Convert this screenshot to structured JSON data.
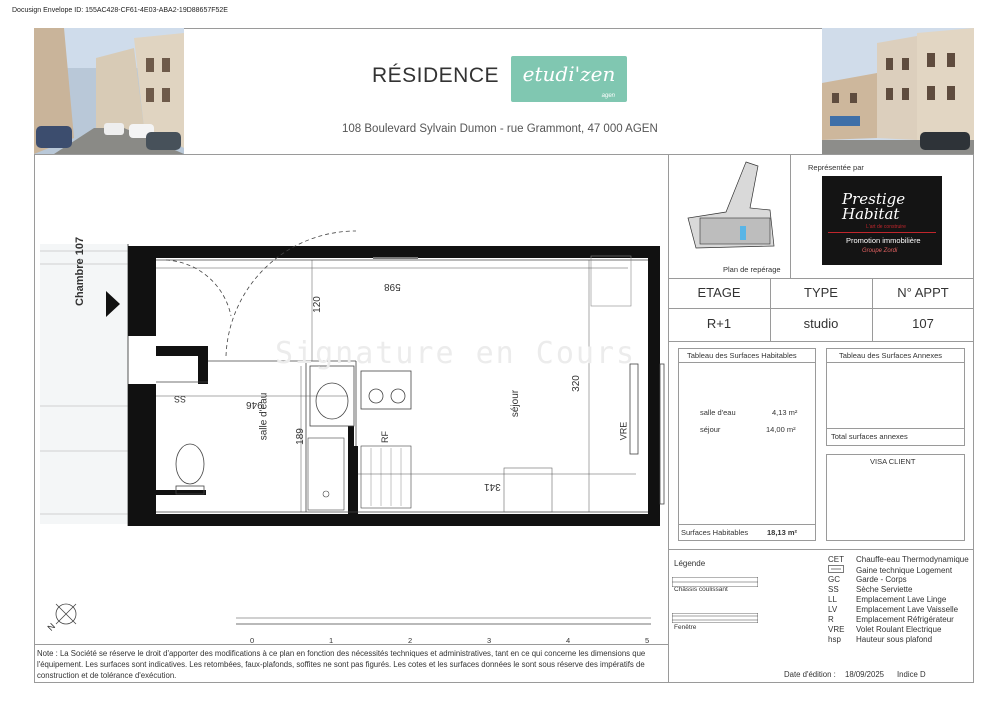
{
  "envelope_id": "Docusign Envelope ID: 155AC428-CF61-4E03-ABA2-19D88657F52E",
  "header": {
    "title": "RÉSIDENCE",
    "logo_text": "etudi'zen",
    "logo_sub": "agen",
    "address": "108 Boulevard Sylvain Dumon - rue Grammont, 47 000 AGEN"
  },
  "plan": {
    "chambre_label": "Chambre 107",
    "watermark": "Signature en Cours",
    "dimensions": [
      "598",
      "120",
      "320",
      "946",
      "189",
      "341"
    ],
    "rooms": {
      "salle_eau": "salle d'eau",
      "sejour": "séjour"
    },
    "codes": {
      "ss": "SS",
      "rf": "RF",
      "vre": "VRE"
    },
    "compass": "N",
    "scale_labels": [
      "0",
      "1",
      "2",
      "3",
      "4",
      "5"
    ]
  },
  "reperage": {
    "label": "Plan de repérage"
  },
  "agency": {
    "represented_by": "Représentée par",
    "name": "Prestige Habitat",
    "tagline": "L'art de construire",
    "line1": "Promotion immobilière",
    "line2": "Groupe Zordi",
    "colors": {
      "bg": "#141414",
      "accent": "#c0262c"
    }
  },
  "info_table": {
    "headers": [
      "ETAGE",
      "TYPE",
      "N° APPT"
    ],
    "values": [
      "R+1",
      "studio",
      "107"
    ]
  },
  "surfaces": {
    "habitables_title": "Tableau des Surfaces Habitables",
    "rows": [
      {
        "label": "salle d'eau",
        "value": "4,13 m²"
      },
      {
        "label": "séjour",
        "value": "14,00 m²"
      }
    ],
    "total_label": "Surfaces Habitables",
    "total_value": "18,13 m²",
    "annexes_title": "Tableau des Surfaces Annexes",
    "annexes_total": "Total surfaces annexes",
    "visa": "VISA CLIENT"
  },
  "legend": {
    "title": "Légende",
    "chassis": "Châssis coulissant",
    "fenetre": "Fenêtre",
    "items": [
      {
        "code": "CET",
        "label": "Chauffe-eau Thermodynamique"
      },
      {
        "code": "",
        "label": "Gaine technique Logement"
      },
      {
        "code": "GC",
        "label": "Garde - Corps"
      },
      {
        "code": "SS",
        "label": "Sèche Serviette"
      },
      {
        "code": "LL",
        "label": "Emplacement Lave Linge"
      },
      {
        "code": "LV",
        "label": "Emplacement Lave Vaisselle"
      },
      {
        "code": "R",
        "label": "Emplacement Réfrigérateur"
      },
      {
        "code": "VRE",
        "label": "Volet Roulant Electrique"
      },
      {
        "code": "hsp",
        "label": "Hauteur sous plafond"
      }
    ]
  },
  "note": "Note : La Société se réserve le droit d'apporter des modifications à ce plan en fonction des nécessités techniques et administratives, tant en ce qui concerne les dimensions que l'équipement. Les surfaces sont indicatives. Les retombées, faux-plafonds, soffites ne sont pas figurés. Les cotes et les surfaces données le sont sous réserve des impératifs de construction et de tolérance d'exécution.",
  "footer": {
    "date_label": "Date d'édition :",
    "date": "18/09/2025",
    "indice": "Indice D"
  }
}
